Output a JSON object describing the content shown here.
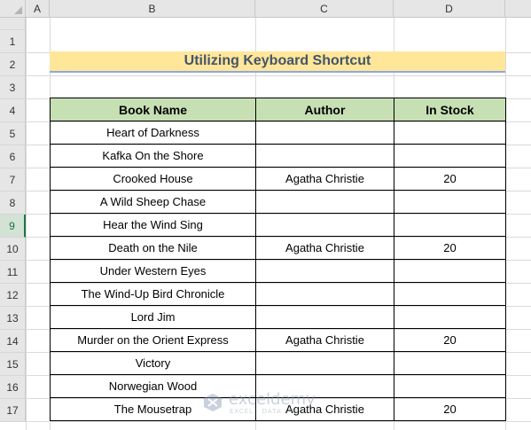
{
  "columns": [
    "A",
    "B",
    "C",
    "D"
  ],
  "rows": [
    "1",
    "2",
    "3",
    "4",
    "5",
    "6",
    "7",
    "8",
    "9",
    "10",
    "11",
    "12",
    "13",
    "14",
    "15",
    "16",
    "17"
  ],
  "active_row": "9",
  "title": "Utilizing Keyboard Shortcut",
  "table": {
    "headers": [
      "Book Name",
      "Author",
      "In Stock"
    ],
    "rows": [
      [
        "Heart of Darkness",
        "",
        ""
      ],
      [
        "Kafka On the Shore",
        "",
        ""
      ],
      [
        "Crooked House",
        "Agatha Christie",
        "20"
      ],
      [
        "A Wild Sheep Chase",
        "",
        ""
      ],
      [
        "Hear the Wind Sing",
        "",
        ""
      ],
      [
        "Death on the Nile",
        "Agatha Christie",
        "20"
      ],
      [
        "Under Western Eyes",
        "",
        ""
      ],
      [
        "The Wind-Up Bird Chronicle",
        "",
        ""
      ],
      [
        "Lord Jim",
        "",
        ""
      ],
      [
        "Murder on the Orient Express",
        "Agatha Christie",
        "20"
      ],
      [
        "Victory",
        "",
        ""
      ],
      [
        "Norwegian Wood",
        "",
        ""
      ],
      [
        "The Mousetrap",
        "Agatha Christie",
        "20"
      ]
    ]
  },
  "watermark": {
    "name": "exceldemy",
    "tagline": "EXCEL · DATA · BI"
  },
  "colors": {
    "title_fill": "#ffe699",
    "header_fill": "#c6e0b4",
    "title_text": "#44546a",
    "active_row": "#217346"
  }
}
